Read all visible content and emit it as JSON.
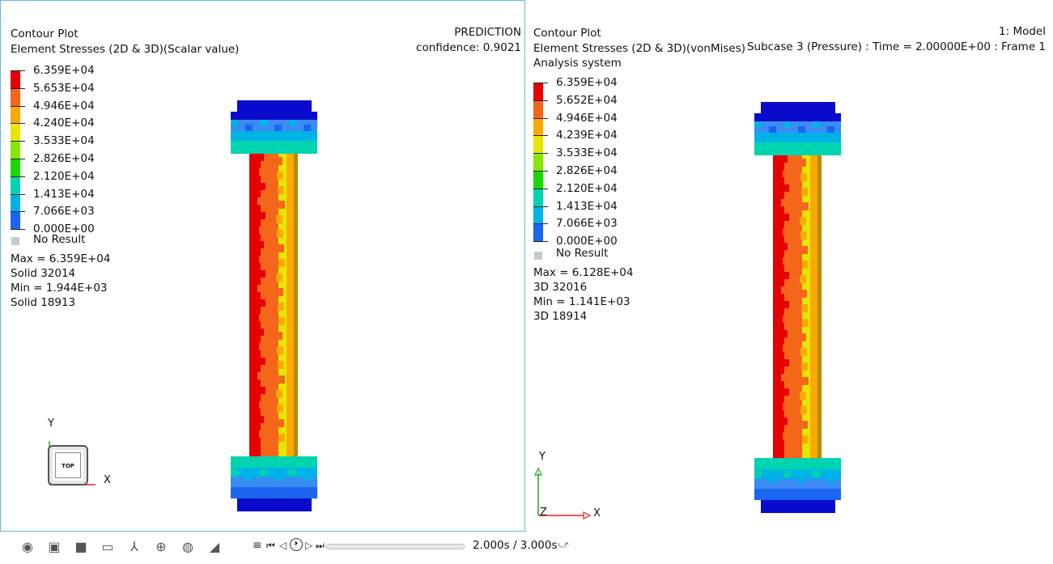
{
  "left": {
    "title": "Contour Plot",
    "subtitle": "Element Stresses (2D & 3D)(Scalar value)",
    "corner_title": "PREDICTION",
    "corner_subtitle": "confidence: 0.9021",
    "legend": [
      "6.359E+04",
      "5.653E+04",
      "4.946E+04",
      "4.240E+04",
      "3.533E+04",
      "2.826E+04",
      "2.120E+04",
      "1.413E+04",
      "7.066E+03",
      "0.000E+00"
    ],
    "no_result": "No Result",
    "stats": [
      "Max =  6.359E+04",
      "Solid 32014",
      "Min =  1.944E+03",
      "Solid 18913"
    ],
    "axis_y": "Y",
    "axis_x": "X",
    "view_cube_label": "TOP"
  },
  "right": {
    "title": "Contour Plot",
    "subtitle": "Element Stresses (2D & 3D)(vonMises)",
    "subtitle2": "Analysis system",
    "corner_title": "1: Model",
    "corner_subtitle": "Subcase 3 (Pressure) : Time = 2.00000E+00 : Frame 1",
    "legend": [
      "6.359E+04",
      "5.652E+04",
      "4.946E+04",
      "4.239E+04",
      "3.533E+04",
      "2.826E+04",
      "2.120E+04",
      "1.413E+04",
      "7.066E+03",
      "0.000E+00"
    ],
    "no_result": "No Result",
    "stats": [
      "Max =  6.128E+04",
      "3D 32016",
      "Min =  1.141E+03",
      "3D 18914"
    ],
    "axis_y": "Y",
    "axis_x": "X",
    "axis_z": "Z"
  },
  "legend_colors": [
    "#e60000",
    "#f4661a",
    "#f9aa00",
    "#e7e600",
    "#88e600",
    "#1fd700",
    "#00d4ae",
    "#00b3e6",
    "#1a66f0",
    "#0000c8"
  ],
  "toolbar": {
    "icons": [
      "eye-icon",
      "camera-icon",
      "cube-icon",
      "legend-icon",
      "axes-icon",
      "zoom-icon",
      "3d-icon",
      "slice-icon"
    ],
    "menu_glyph": "≡",
    "first_glyph": "⏮",
    "prev_glyph": "◁",
    "play_glyph": "⏵",
    "next_glyph": "▷",
    "last_glyph": "⏭",
    "time": "2.000s / 3.000s",
    "curve_glyph": "⤻"
  }
}
